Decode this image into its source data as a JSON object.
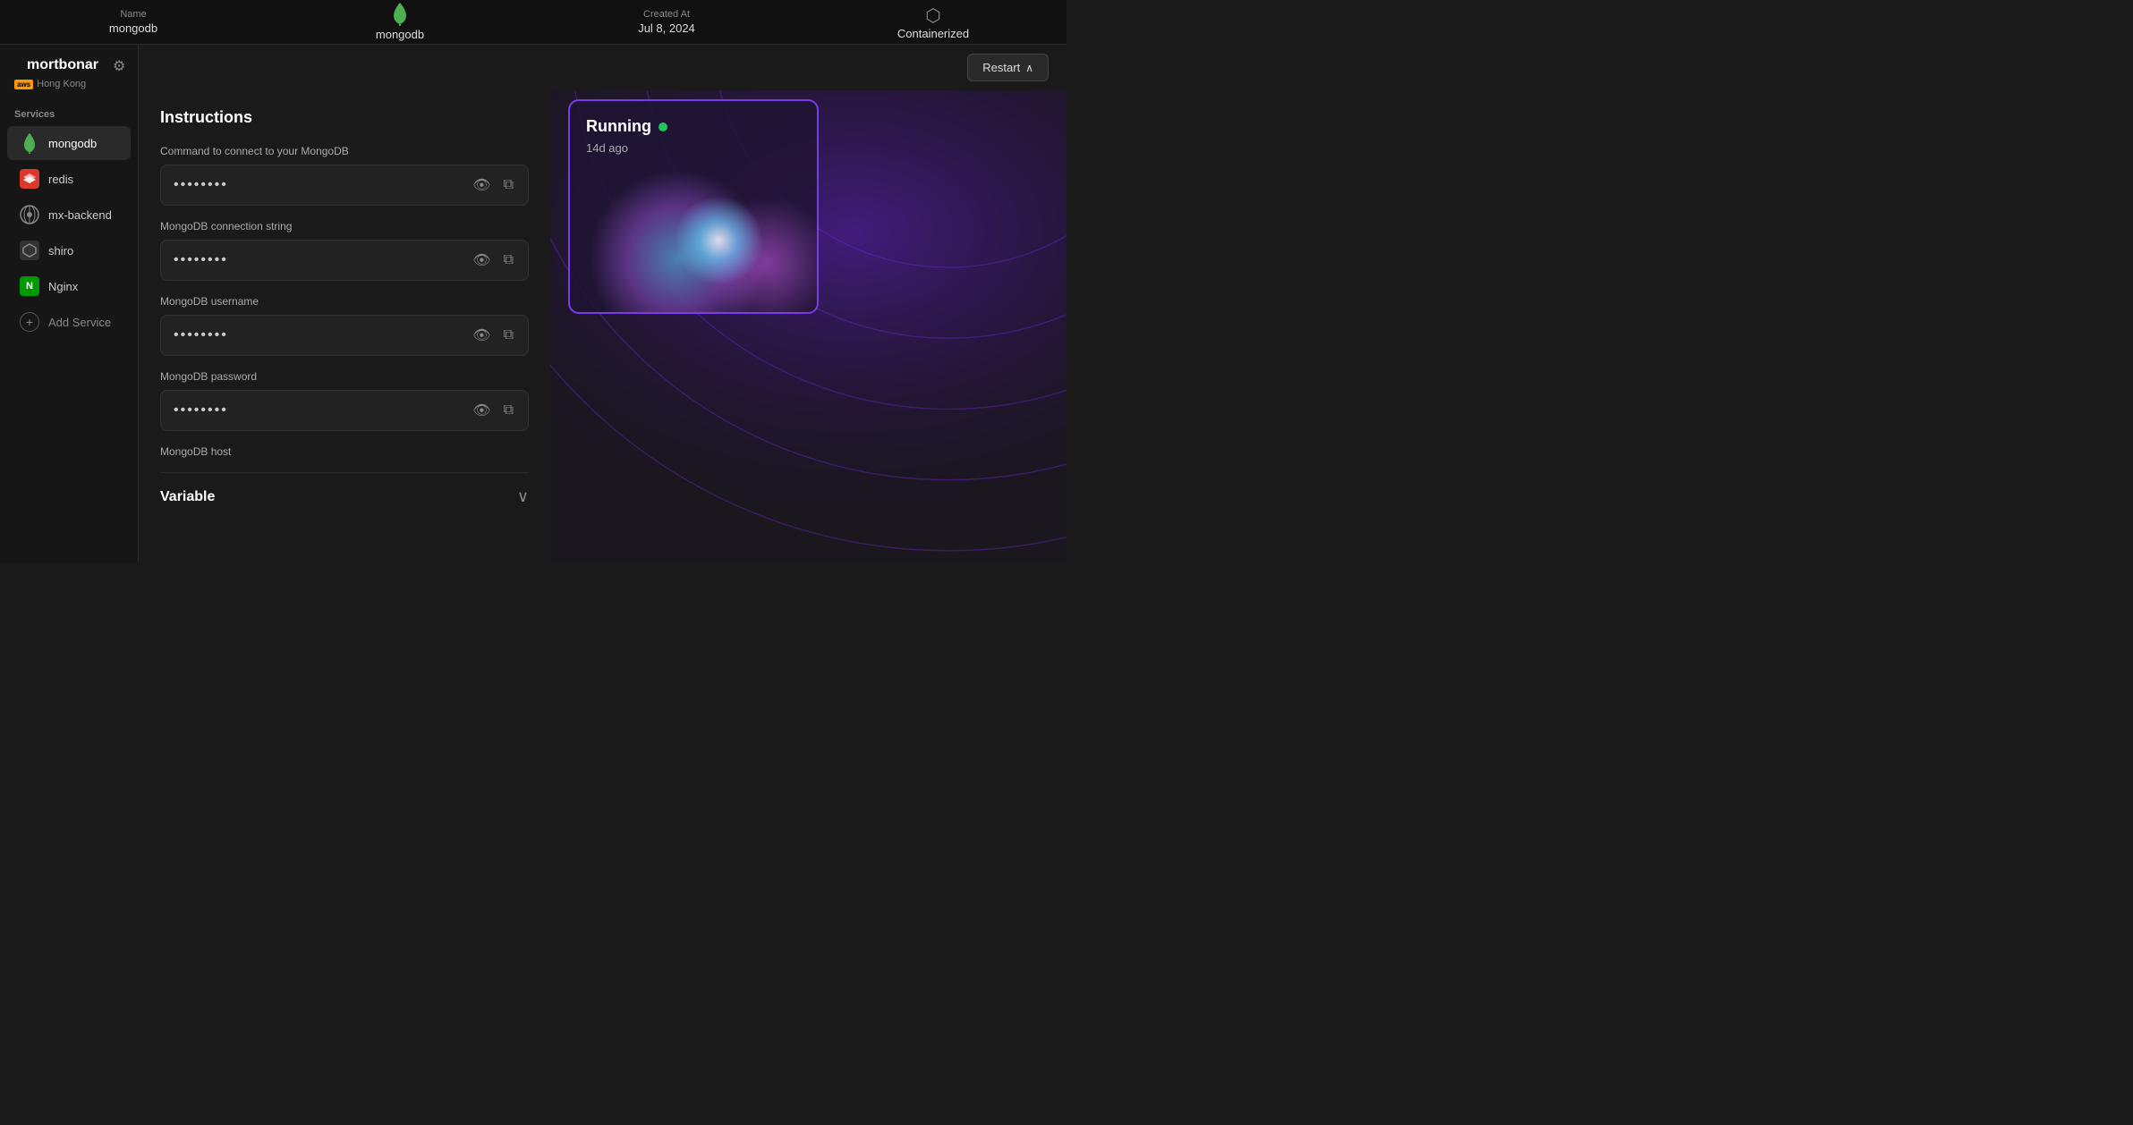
{
  "app": {
    "name": "mortbonar",
    "region": "Hong Kong",
    "aws_label": "aws"
  },
  "top_bar": {
    "name_label": "Name",
    "name_value": "mongodb",
    "created_label": "Created At",
    "created_value": "Jul 8, 2024",
    "type_label": "Containerized"
  },
  "sidebar": {
    "section_label": "Services",
    "settings_title": "Settings",
    "items": [
      {
        "id": "mongodb",
        "label": "mongodb",
        "icon_type": "mongo",
        "active": true
      },
      {
        "id": "redis",
        "label": "redis",
        "icon_type": "redis",
        "active": false
      },
      {
        "id": "mx-backend",
        "label": "mx-backend",
        "icon_type": "mx",
        "active": false
      },
      {
        "id": "shiro",
        "label": "shiro",
        "icon_type": "shiro",
        "active": false
      },
      {
        "id": "nginx",
        "label": "Nginx",
        "icon_type": "nginx",
        "active": false
      }
    ],
    "add_service_label": "Add Service"
  },
  "instructions": {
    "title": "Instructions",
    "fields": [
      {
        "label": "Command to connect to your MongoDB",
        "value": "••••••••"
      },
      {
        "label": "MongoDB connection string",
        "value": "••••••••"
      },
      {
        "label": "MongoDB username",
        "value": "••••••••"
      },
      {
        "label": "MongoDB password",
        "value": "••••••••"
      },
      {
        "label": "MongoDB host",
        "value": ""
      }
    ]
  },
  "variable_section": {
    "title": "Variable"
  },
  "status_card": {
    "status": "Running",
    "time_ago": "14d ago"
  },
  "restart_button": {
    "label": "Restart"
  }
}
